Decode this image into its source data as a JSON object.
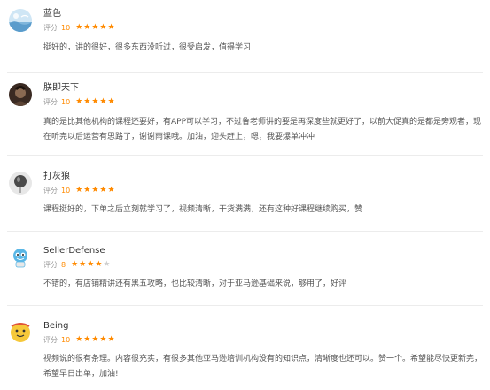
{
  "reviews": [
    {
      "user": "蓝色",
      "avatar_icon": "blue-landscape-avatar-icon",
      "rating_label": "评分",
      "score": "10",
      "stars": 5,
      "max_stars": 5,
      "text": "挺好的，讲的很好，很多东西没听过，很受启发，值得学习"
    },
    {
      "user": "朕即天下",
      "avatar_icon": "dark-photo-avatar-icon",
      "rating_label": "评分",
      "score": "10",
      "stars": 5,
      "max_stars": 5,
      "text": "真的是比其他机构的课程还要好，有APP可以学习，不过鲁老师讲的要是再深度些就更好了，以前大促真的是都是旁观者，现在听完以后运营有思路了，谢谢雨课哦。加油，迎头赶上，嗯，我要爆单冲冲"
    },
    {
      "user": "打灰狼",
      "avatar_icon": "balloon-avatar-icon",
      "rating_label": "评分",
      "score": "10",
      "stars": 5,
      "max_stars": 5,
      "text": "课程挺好的，下单之后立刻就学习了，视频清晰，干货满满，还有这种好课程继续购买，赞"
    },
    {
      "user": "SellerDefense",
      "avatar_icon": "cartoon-robot-avatar-icon",
      "rating_label": "评分",
      "score": "8",
      "stars": 4,
      "max_stars": 5,
      "text": "不错的，有店铺精讲还有黑五攻略，也比较清晰，对于亚马逊基础来说，够用了，好评"
    },
    {
      "user": "Being",
      "avatar_icon": "yellow-face-avatar-icon",
      "rating_label": "评分",
      "score": "10",
      "stars": 5,
      "max_stars": 5,
      "text": "视频说的很有条理。内容很充实，有很多其他亚马逊培训机构没有的知识点，清晰度也还可以。赞一个。希望能尽快更新完，希望早日出单，加油!"
    }
  ],
  "colors": {
    "star_on": "#ff8a00",
    "star_off": "#cfcfcf",
    "score": "#ff8a00",
    "text": "#555555",
    "divider": "#ececec"
  }
}
